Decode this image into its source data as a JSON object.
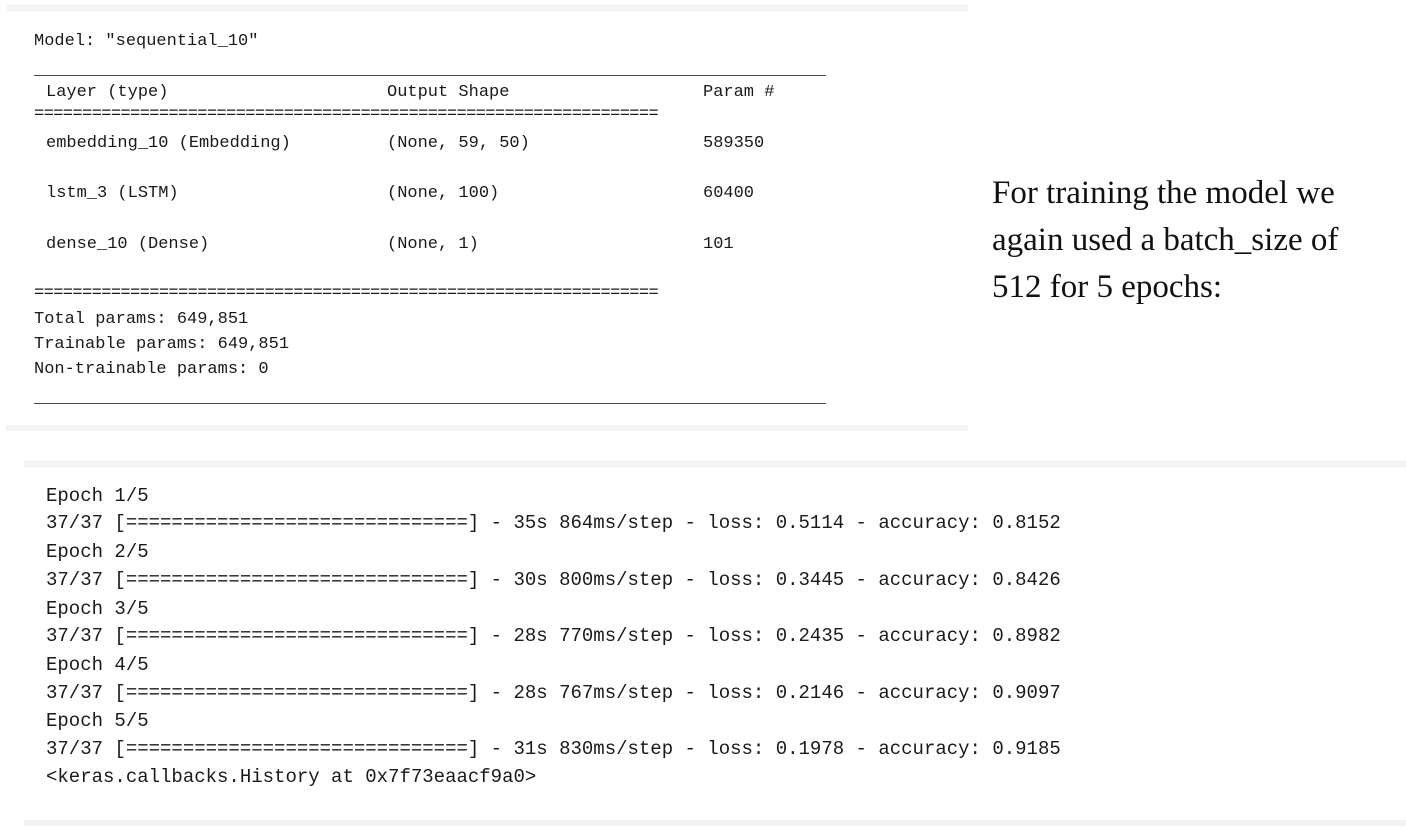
{
  "summary": {
    "model_line": "Model: \"sequential_10\"",
    "headers": {
      "layer": "Layer (type)",
      "output": "Output Shape",
      "params": "Param #"
    },
    "equals_line": "=================================================================",
    "rows": [
      {
        "layer": "embedding_10 (Embedding)",
        "output": "(None, 59, 50)",
        "params": "589350"
      },
      {
        "layer": "lstm_3 (LSTM)",
        "output": "(None, 100)",
        "params": "60400"
      },
      {
        "layer": "dense_10 (Dense)",
        "output": "(None, 1)",
        "params": "101"
      }
    ],
    "total": "Total params: 649,851",
    "trainable": "Trainable params: 649,851",
    "non_trainable": "Non-trainable params: 0"
  },
  "side_text": {
    "line1": "For training the model we",
    "line2": "again used a batch_size of",
    "line3": "512 for 5 epochs:"
  },
  "training": {
    "epochs": [
      {
        "epoch": "Epoch 1/5",
        "progress": "37/37 [==============================] - 35s 864ms/step - loss: 0.5114 - accuracy: 0.8152"
      },
      {
        "epoch": "Epoch 2/5",
        "progress": "37/37 [==============================] - 30s 800ms/step - loss: 0.3445 - accuracy: 0.8426"
      },
      {
        "epoch": "Epoch 3/5",
        "progress": "37/37 [==============================] - 28s 770ms/step - loss: 0.2435 - accuracy: 0.8982"
      },
      {
        "epoch": "Epoch 4/5",
        "progress": "37/37 [==============================] - 28s 767ms/step - loss: 0.2146 - accuracy: 0.9097"
      },
      {
        "epoch": "Epoch 5/5",
        "progress": "37/37 [==============================] - 31s 830ms/step - loss: 0.1978 - accuracy: 0.9185"
      }
    ],
    "result": "<keras.callbacks.History at 0x7f73eaacf9a0>"
  }
}
